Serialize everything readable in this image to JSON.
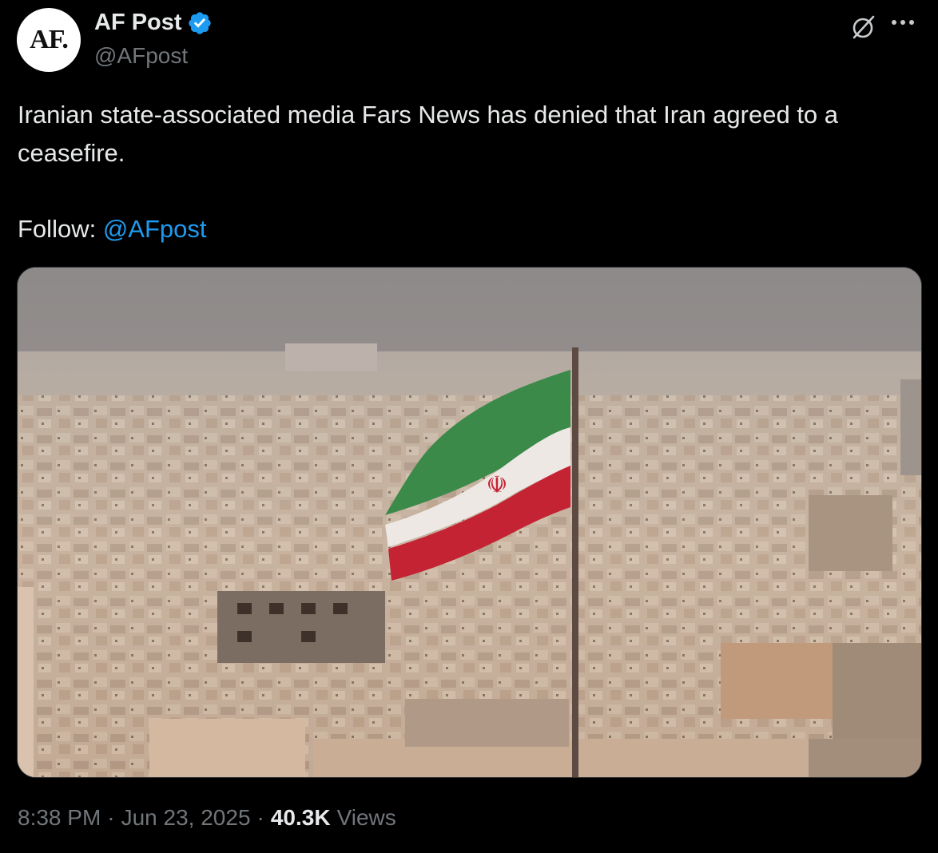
{
  "author": {
    "avatar_text": "AF.",
    "display_name": "AF Post",
    "handle": "@AFpost",
    "verified": true
  },
  "tweet": {
    "text": "Iranian state-associated media Fars News has denied that Iran agreed to a ceasefire.",
    "follow_label": "Follow:",
    "follow_mention": "@AFpost"
  },
  "media": {
    "description_icon": "photo-iran-flag-over-city"
  },
  "meta": {
    "time": "8:38 PM",
    "separator": "·",
    "date": "Jun 23, 2025",
    "views_count": "40.3K",
    "views_label": "Views"
  },
  "colors": {
    "background": "#000000",
    "text": "#e7e9ea",
    "muted": "#71767b",
    "link": "#1d9bf0",
    "verified": "#1d9bf0"
  },
  "icons": {
    "verified": "verified-badge-icon",
    "grok": "grok-icon",
    "more": "more-options-icon"
  }
}
